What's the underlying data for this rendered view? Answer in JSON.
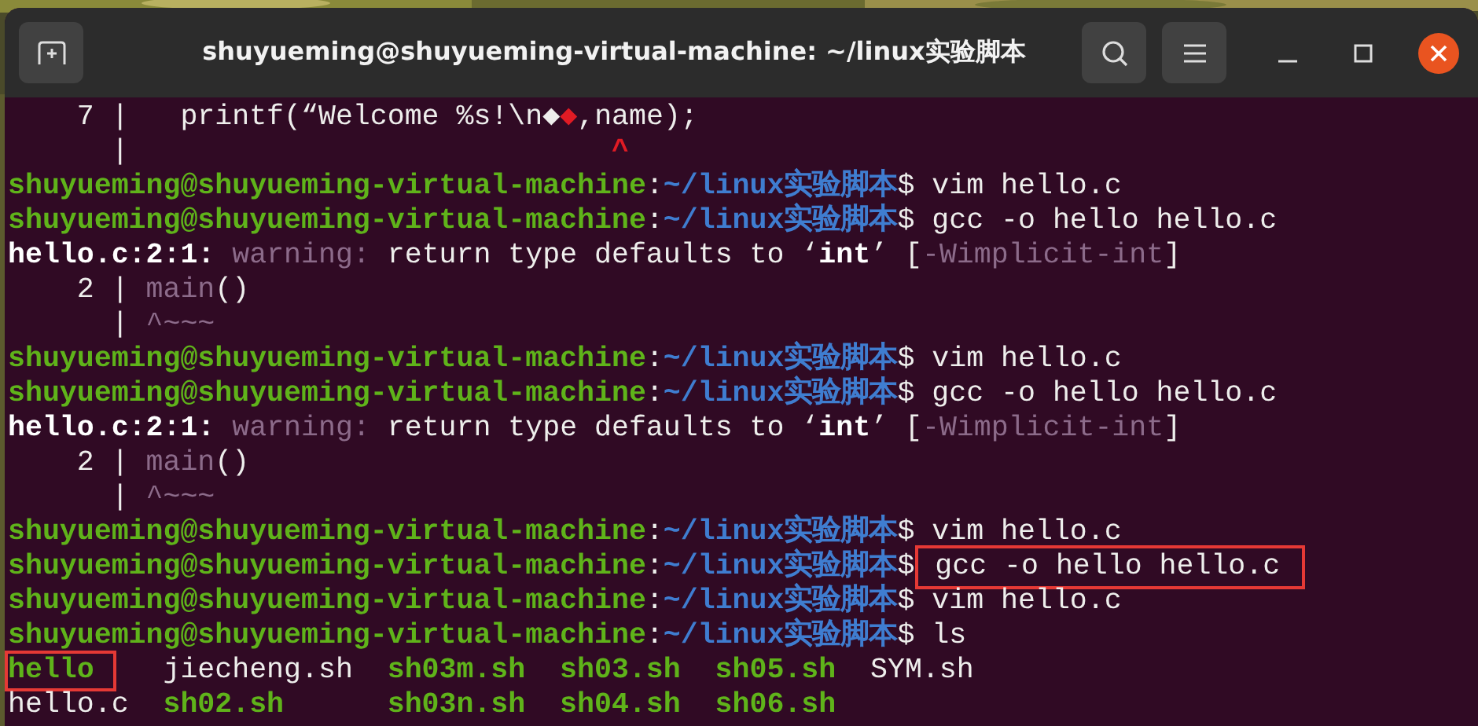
{
  "window": {
    "title": "shuyueming@shuyueming-virtual-machine: ~/linux实验脚本"
  },
  "lines": [
    {
      "kind": "text",
      "segments": [
        {
          "text": "    7 |   printf(“Welcome %s!\\n◆",
          "kind": "plain"
        },
        {
          "text": "◆",
          "kind": "error"
        },
        {
          "text": ",name);",
          "kind": "plain"
        }
      ]
    },
    {
      "kind": "text",
      "segments": [
        {
          "text": "      |                            ",
          "kind": "plain"
        },
        {
          "text": "^",
          "kind": "error"
        }
      ]
    },
    {
      "kind": "prompt",
      "user_host": "shuyueming@shuyueming-virtual-machine",
      "separator": ":",
      "path": "~/linux实验脚本",
      "sign": "$",
      "command": "vim hello.c",
      "highlighted": false
    },
    {
      "kind": "prompt",
      "user_host": "shuyueming@shuyueming-virtual-machine",
      "separator": ":",
      "path": "~/linux实验脚本",
      "sign": "$",
      "command": "gcc -o hello hello.c",
      "highlighted": false
    },
    {
      "kind": "text",
      "segments": [
        {
          "text": "hello.c:2:1:",
          "kind": "bold"
        },
        {
          "text": " warning:",
          "kind": "dim"
        },
        {
          "text": " return type defaults to ‘",
          "kind": "plain"
        },
        {
          "text": "int",
          "kind": "bold"
        },
        {
          "text": "’ [",
          "kind": "plain"
        },
        {
          "text": "-Wimplicit-int",
          "kind": "dim"
        },
        {
          "text": "]",
          "kind": "plain"
        }
      ]
    },
    {
      "kind": "text",
      "segments": [
        {
          "text": "    2 | ",
          "kind": "plain"
        },
        {
          "text": "main",
          "kind": "dim"
        },
        {
          "text": "()",
          "kind": "plain"
        }
      ]
    },
    {
      "kind": "text",
      "segments": [
        {
          "text": "      | ",
          "kind": "plain"
        },
        {
          "text": "^~~~",
          "kind": "dim"
        }
      ]
    },
    {
      "kind": "prompt",
      "user_host": "shuyueming@shuyueming-virtual-machine",
      "separator": ":",
      "path": "~/linux实验脚本",
      "sign": "$",
      "command": "vim hello.c",
      "highlighted": false
    },
    {
      "kind": "prompt",
      "user_host": "shuyueming@shuyueming-virtual-machine",
      "separator": ":",
      "path": "~/linux实验脚本",
      "sign": "$",
      "command": "gcc -o hello hello.c",
      "highlighted": false
    },
    {
      "kind": "text",
      "segments": [
        {
          "text": "hello.c:2:1:",
          "kind": "bold"
        },
        {
          "text": " warning:",
          "kind": "dim"
        },
        {
          "text": " return type defaults to ‘",
          "kind": "plain"
        },
        {
          "text": "int",
          "kind": "bold"
        },
        {
          "text": "’ [",
          "kind": "plain"
        },
        {
          "text": "-Wimplicit-int",
          "kind": "dim"
        },
        {
          "text": "]",
          "kind": "plain"
        }
      ]
    },
    {
      "kind": "text",
      "segments": [
        {
          "text": "    2 | ",
          "kind": "plain"
        },
        {
          "text": "main",
          "kind": "dim"
        },
        {
          "text": "()",
          "kind": "plain"
        }
      ]
    },
    {
      "kind": "text",
      "segments": [
        {
          "text": "      | ",
          "kind": "plain"
        },
        {
          "text": "^~~~",
          "kind": "dim"
        }
      ]
    },
    {
      "kind": "prompt",
      "user_host": "shuyueming@shuyueming-virtual-machine",
      "separator": ":",
      "path": "~/linux实验脚本",
      "sign": "$",
      "command": "vim hello.c",
      "highlighted": false
    },
    {
      "kind": "prompt",
      "user_host": "shuyueming@shuyueming-virtual-machine",
      "separator": ":",
      "path": "~/linux实验脚本",
      "sign": "$",
      "command": "gcc -o hello hello.c",
      "highlighted": true
    },
    {
      "kind": "prompt",
      "user_host": "shuyueming@shuyueming-virtual-machine",
      "separator": ":",
      "path": "~/linux实验脚本",
      "sign": "$",
      "command": "vim hello.c",
      "highlighted": false
    },
    {
      "kind": "prompt",
      "user_host": "shuyueming@shuyueming-virtual-machine",
      "separator": ":",
      "path": "~/linux实验脚本",
      "sign": "$",
      "command": "ls",
      "highlighted": false
    },
    {
      "kind": "listing",
      "entries": [
        {
          "name": "hello",
          "kind": "executable",
          "highlighted": true
        },
        {
          "name": "jiecheng.sh",
          "kind": "file",
          "highlighted": false
        },
        {
          "name": "sh03m.sh",
          "kind": "executable",
          "highlighted": false
        },
        {
          "name": "sh03.sh",
          "kind": "executable",
          "highlighted": false
        },
        {
          "name": "sh05.sh",
          "kind": "executable",
          "highlighted": false
        },
        {
          "name": "SYM.sh",
          "kind": "file",
          "highlighted": false
        }
      ]
    },
    {
      "kind": "listing",
      "entries": [
        {
          "name": "hello.c",
          "kind": "file",
          "highlighted": false
        },
        {
          "name": "sh02.sh",
          "kind": "executable",
          "highlighted": false
        },
        {
          "name": "sh03n.sh",
          "kind": "executable",
          "highlighted": false
        },
        {
          "name": "sh04.sh",
          "kind": "executable",
          "highlighted": false
        },
        {
          "name": "sh06.sh",
          "kind": "executable",
          "highlighted": false
        }
      ]
    }
  ]
}
